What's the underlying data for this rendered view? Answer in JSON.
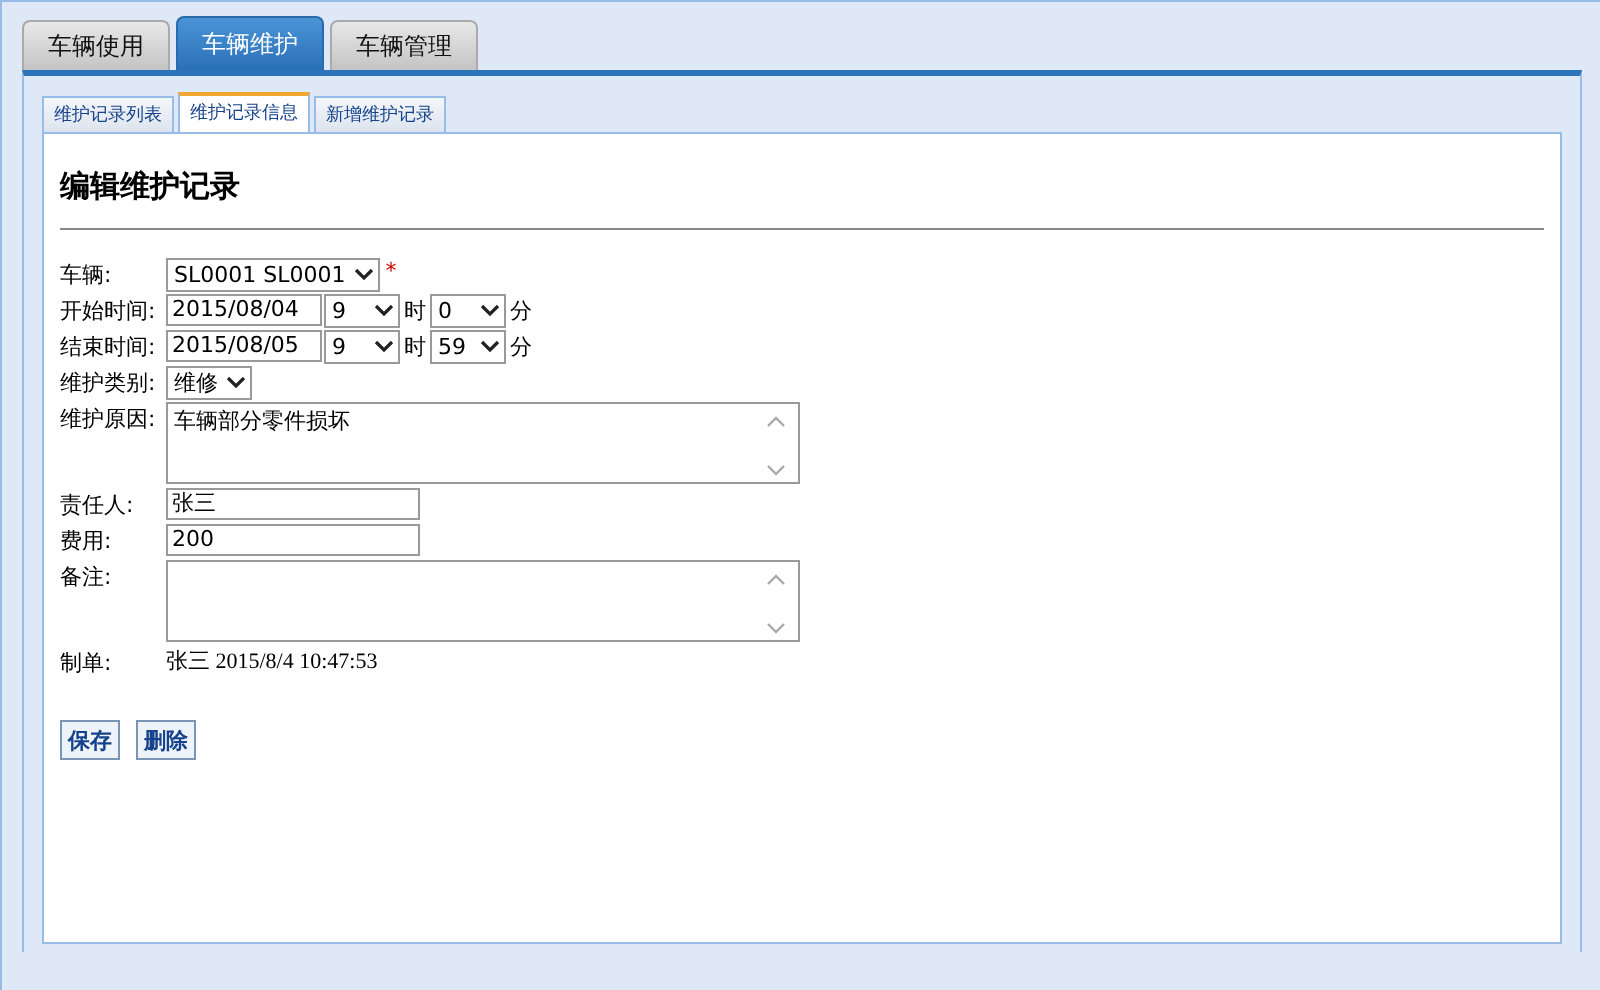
{
  "tabs": [
    {
      "label": "车辆使用",
      "selected": false
    },
    {
      "label": "车辆维护",
      "selected": true
    },
    {
      "label": "车辆管理",
      "selected": false
    }
  ],
  "subtabs": [
    {
      "label": "维护记录列表",
      "selected": false
    },
    {
      "label": "维护记录信息",
      "selected": true
    },
    {
      "label": "新增维护记录",
      "selected": false
    }
  ],
  "title": "编辑维护记录",
  "fields": [
    {
      "kind": "select",
      "label": "车辆:",
      "value": "SL0001 SL0001",
      "required_mark": "*"
    },
    {
      "kind": "datetime",
      "label": "开始时间:",
      "date": "2015/08/04",
      "hour": "9",
      "hour_unit": "时",
      "minute": "0",
      "minute_unit": "分"
    },
    {
      "kind": "datetime",
      "label": "结束时间:",
      "date": "2015/08/05",
      "hour": "9",
      "hour_unit": "时",
      "minute": "59",
      "minute_unit": "分"
    },
    {
      "kind": "select",
      "label": "维护类别:",
      "value": "维修"
    },
    {
      "kind": "textarea",
      "label": "维护原因:",
      "value": "车辆部分零件损坏"
    },
    {
      "kind": "text",
      "label": "责任人:",
      "value": "张三"
    },
    {
      "kind": "text",
      "label": "费用:",
      "value": "200"
    },
    {
      "kind": "textarea",
      "label": "备注:"
    },
    {
      "kind": "static",
      "label": "制单:",
      "value": "张三 2015/8/4 10:47:53"
    }
  ],
  "buttons": [
    "保存",
    "删除"
  ]
}
